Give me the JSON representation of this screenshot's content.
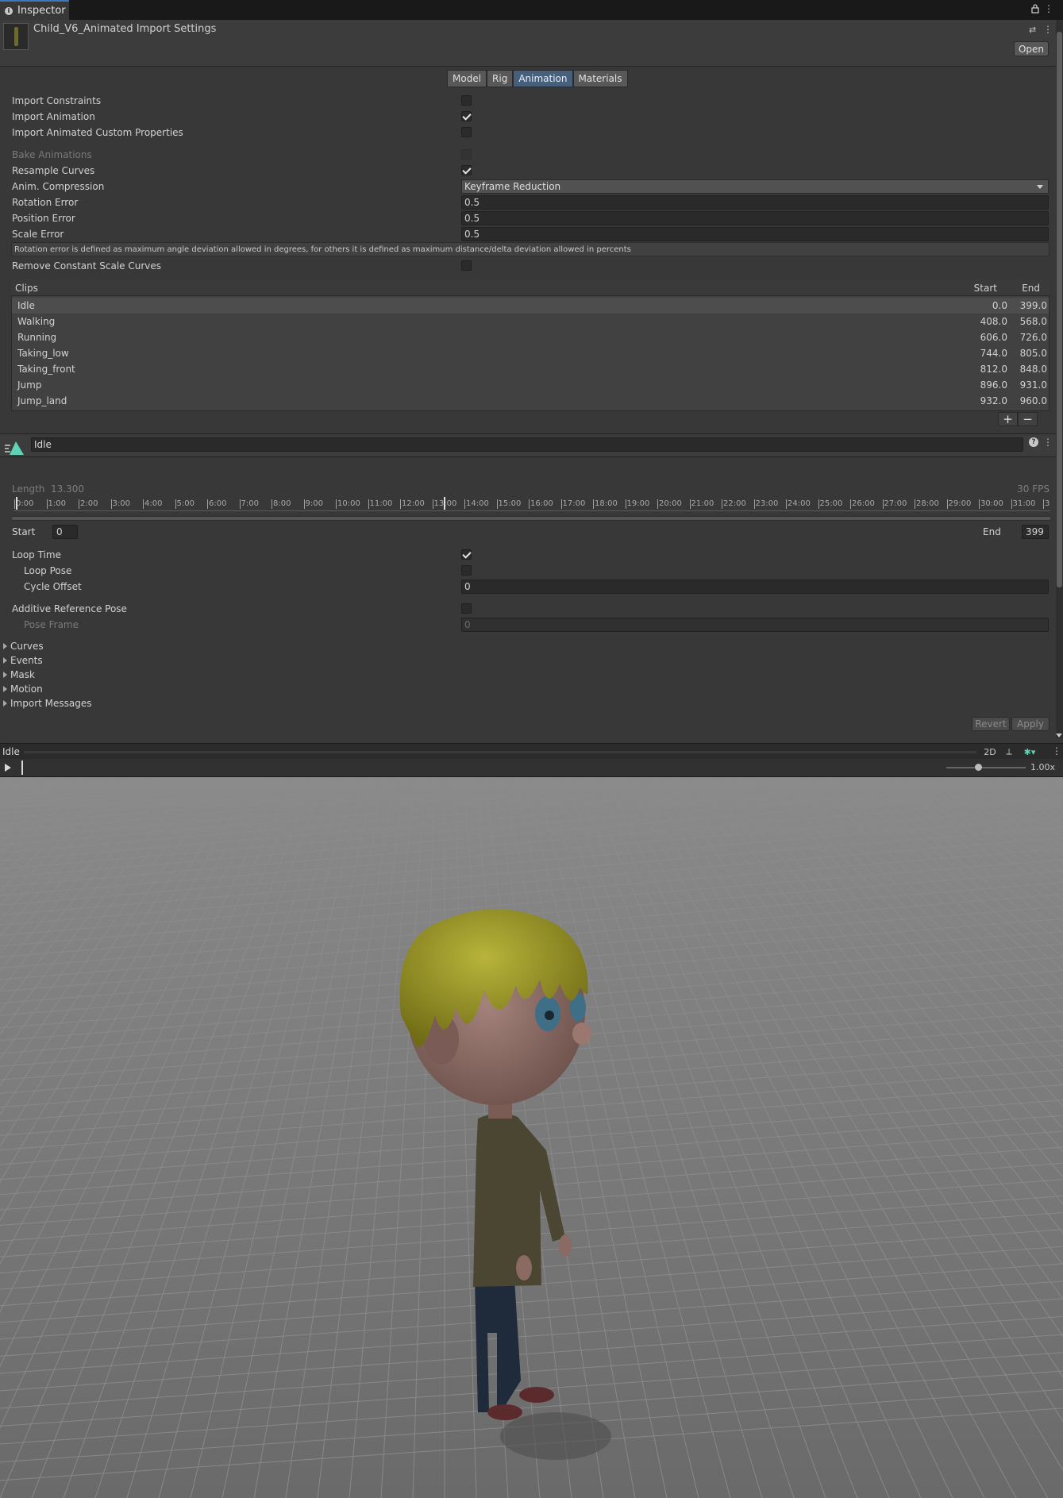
{
  "window": {
    "tab_title": "Inspector",
    "asset_title": "Child_V6_Animated Import Settings",
    "open_label": "Open"
  },
  "tabs": [
    {
      "label": "Model"
    },
    {
      "label": "Rig"
    },
    {
      "label": "Animation",
      "active": true
    },
    {
      "label": "Materials"
    }
  ],
  "settings": {
    "import_constraints": {
      "label": "Import Constraints",
      "checked": false
    },
    "import_animation": {
      "label": "Import Animation",
      "checked": true
    },
    "import_custom_props": {
      "label": "Import Animated Custom Properties",
      "checked": false
    },
    "bake_animations": {
      "label": "Bake Animations",
      "checked": false,
      "disabled": true
    },
    "resample_curves": {
      "label": "Resample Curves",
      "checked": true
    },
    "anim_compression": {
      "label": "Anim. Compression",
      "value": "Keyframe Reduction"
    },
    "rotation_error": {
      "label": "Rotation Error",
      "value": "0.5"
    },
    "position_error": {
      "label": "Position Error",
      "value": "0.5"
    },
    "scale_error": {
      "label": "Scale Error",
      "value": "0.5"
    },
    "help_text": "Rotation error is defined as maximum angle deviation allowed in degrees, for others it is defined as maximum distance/delta deviation allowed in percents",
    "remove_constant_scale": {
      "label": "Remove Constant Scale Curves",
      "checked": false
    }
  },
  "clips": {
    "header": {
      "name": "Clips",
      "start": "Start",
      "end": "End"
    },
    "rows": [
      {
        "name": "Idle",
        "start": "0.0",
        "end": "399.0",
        "selected": true
      },
      {
        "name": "Walking",
        "start": "408.0",
        "end": "568.0"
      },
      {
        "name": "Running",
        "start": "606.0",
        "end": "726.0"
      },
      {
        "name": "Taking_low",
        "start": "744.0",
        "end": "805.0"
      },
      {
        "name": "Taking_front",
        "start": "812.0",
        "end": "848.0"
      },
      {
        "name": "Jump",
        "start": "896.0",
        "end": "931.0"
      },
      {
        "name": "Jump_land",
        "start": "932.0",
        "end": "960.0"
      }
    ],
    "add_label": "+",
    "remove_label": "−"
  },
  "clip_detail": {
    "name": "Idle",
    "length_label": "Length",
    "length_value": "13.300",
    "fps": "30 FPS",
    "ticks": [
      "0:00",
      "1:00",
      "2:00",
      "3:00",
      "4:00",
      "5:00",
      "6:00",
      "7:00",
      "8:00",
      "9:00",
      "10:00",
      "11:00",
      "12:00",
      "13:00",
      "14:00",
      "15:00",
      "16:00",
      "17:00",
      "18:00",
      "19:00",
      "20:00",
      "21:00",
      "22:00",
      "23:00",
      "24:00",
      "25:00",
      "26:00",
      "27:00",
      "28:00",
      "29:00",
      "30:00",
      "31:00",
      "3"
    ],
    "start_label": "Start",
    "start_value": "0",
    "end_label": "End",
    "end_value": "399",
    "loop_time": {
      "label": "Loop Time",
      "checked": true
    },
    "loop_pose": {
      "label": "Loop Pose",
      "checked": false
    },
    "cycle_offset": {
      "label": "Cycle Offset",
      "value": "0"
    },
    "additive_ref": {
      "label": "Additive Reference Pose",
      "checked": false
    },
    "pose_frame": {
      "label": "Pose Frame",
      "value": "0",
      "disabled": true
    }
  },
  "foldouts": [
    "Curves",
    "Events",
    "Mask",
    "Motion",
    "Import Messages"
  ],
  "footer": {
    "revert_label": "Revert",
    "apply_label": "Apply"
  },
  "preview": {
    "clip_name": "Idle",
    "speed": "1.00x",
    "speed_fraction": 0.4
  },
  "colors": {
    "active_tab": "#46607c",
    "panel_bg": "#383838",
    "hair": "#8f8b1e",
    "shirt": "#4b4632",
    "jeans": "#1f2a3a"
  }
}
